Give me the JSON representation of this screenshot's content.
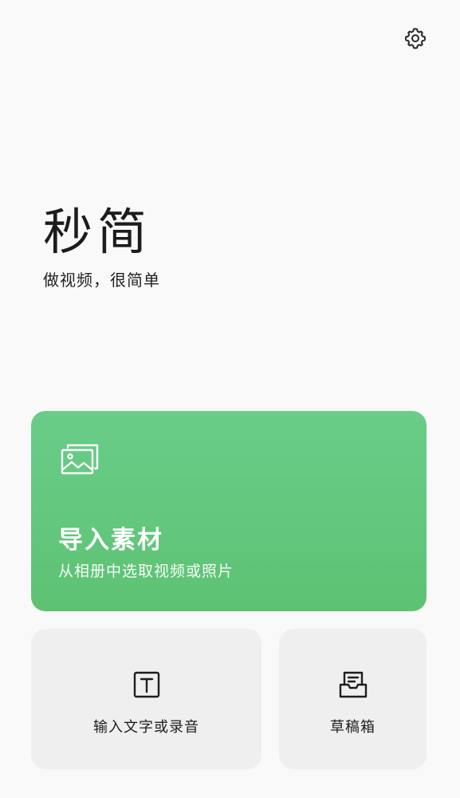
{
  "header": {
    "settings_icon": "gear-icon"
  },
  "brand": {
    "logo": "秒简",
    "tagline": "做视频，很简单"
  },
  "import_card": {
    "icon": "images-icon",
    "title": "导入素材",
    "subtitle": "从相册中选取视频或照片",
    "color": "#5ec273"
  },
  "actions": {
    "text_or_record": {
      "icon": "text-box-icon",
      "label": "输入文字或录音"
    },
    "drafts": {
      "icon": "drafts-box-icon",
      "label": "草稿箱"
    }
  }
}
